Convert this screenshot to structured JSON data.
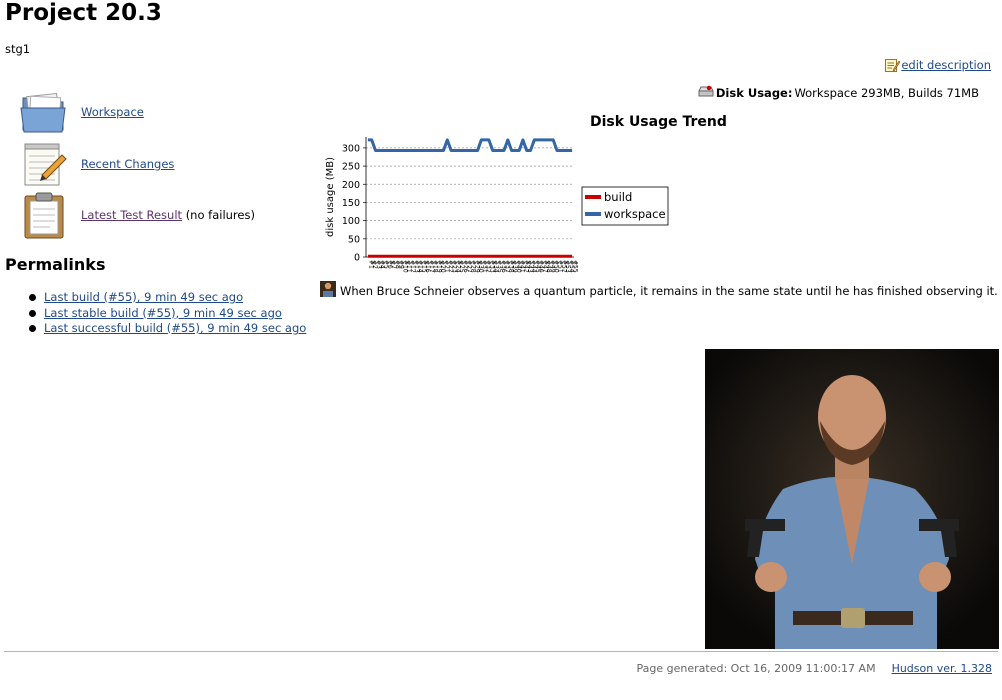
{
  "page": {
    "title": "Project 20.3",
    "description": "stg1",
    "edit_description": "edit description"
  },
  "tasks": [
    {
      "label": "Workspace",
      "icon": "folder-icon"
    },
    {
      "label": "Recent Changes",
      "icon": "notepad-icon"
    },
    {
      "label": "Latest Test Result",
      "suffix": "(no failures)",
      "icon": "clipboard-icon"
    }
  ],
  "permalinks": {
    "heading": "Permalinks",
    "items": [
      "Last build (#55), 9 min 49 sec ago",
      "Last stable build (#55), 9 min 49 sec ago",
      "Last successful build (#55), 9 min 49 sec ago"
    ]
  },
  "disk_usage": {
    "label": "Disk Usage:",
    "value": "Workspace 293MB, Builds 71MB"
  },
  "quote": "When Bruce Schneier observes a quantum particle, it remains in the same state until he has finished observing it.",
  "footer": {
    "generated": "Page generated: Oct 16, 2009 11:00:17 AM",
    "version_link": "Hudson ver. 1.328"
  },
  "colors": {
    "link": "#204a87",
    "build_series": "#cc0000",
    "workspace_series": "#3465a4"
  },
  "chart_data": {
    "type": "line",
    "title": "Disk Usage Trend",
    "ylabel": "disk usage (MB)",
    "ylim": [
      0,
      330
    ],
    "yticks": [
      0,
      50,
      100,
      150,
      200,
      250,
      300
    ],
    "grid": true,
    "legend_position": "right",
    "x": [
      1,
      2,
      3,
      4,
      5,
      6,
      7,
      8,
      9,
      10,
      11,
      12,
      13,
      14,
      15,
      16,
      17,
      18,
      19,
      20,
      21,
      22,
      23,
      24,
      25,
      26,
      27,
      28,
      29,
      30,
      31,
      32,
      33,
      34,
      35,
      36,
      37,
      38,
      39,
      40,
      41,
      42,
      43,
      44,
      45,
      46,
      47,
      48,
      49,
      50,
      51,
      52,
      53,
      54,
      55
    ],
    "x_labels_legible": false,
    "series": [
      {
        "name": "build",
        "color": "#cc0000",
        "values": [
          2,
          2,
          2,
          2,
          2,
          2,
          2,
          2,
          2,
          2,
          2,
          2,
          2,
          2,
          2,
          2,
          2,
          2,
          2,
          2,
          2,
          2,
          2,
          2,
          2,
          2,
          2,
          2,
          2,
          2,
          2,
          2,
          2,
          2,
          2,
          2,
          2,
          2,
          2,
          2,
          2,
          2,
          2,
          2,
          2,
          2,
          2,
          2,
          2,
          2,
          2,
          2,
          2,
          2,
          2
        ]
      },
      {
        "name": "workspace",
        "color": "#3465a4",
        "values": [
          322,
          322,
          293,
          293,
          293,
          293,
          293,
          293,
          293,
          293,
          293,
          293,
          293,
          293,
          293,
          293,
          293,
          293,
          293,
          293,
          293,
          322,
          293,
          293,
          293,
          293,
          293,
          293,
          293,
          293,
          322,
          322,
          322,
          293,
          293,
          293,
          293,
          322,
          293,
          293,
          293,
          322,
          293,
          293,
          322,
          322,
          322,
          322,
          322,
          322,
          293,
          293,
          293,
          293,
          293
        ]
      }
    ]
  }
}
